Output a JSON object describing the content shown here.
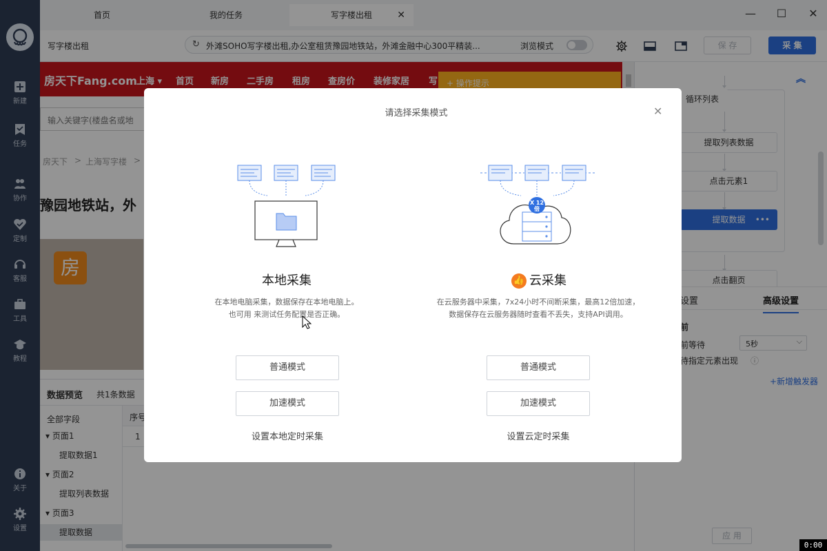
{
  "sidebar": {
    "items": [
      {
        "label": "新建"
      },
      {
        "label": "任务"
      },
      {
        "label": "协作"
      },
      {
        "label": "定制"
      },
      {
        "label": "客服"
      },
      {
        "label": "工具"
      },
      {
        "label": "教程"
      },
      {
        "label": "关于"
      },
      {
        "label": "设置"
      }
    ]
  },
  "tabs": [
    {
      "label": "首页"
    },
    {
      "label": "我的任务"
    },
    {
      "label": "写字楼出租"
    }
  ],
  "toolbar": {
    "task_title": "写字楼出租",
    "url": "外滩SOHO写字楼出租,办公室租赁豫园地铁站，外滩金融中心300平精装...",
    "browse_mode_label": "浏览模式",
    "save_label": "保 存",
    "collect_label": "采 集"
  },
  "webpage": {
    "logo": "房天下Fang.com",
    "city": "上海",
    "nav": [
      "首页",
      "新房",
      "二手房",
      "租房",
      "查房价",
      "装修家居",
      "写"
    ],
    "tip": "+ 操作提示",
    "search_placeholder": "输入关键字(楼盘名或地",
    "breadcrumb": [
      "房天下",
      ">",
      "上海写字楼",
      ">"
    ],
    "headline": "豫园地铁站，外",
    "photo_logo": "房"
  },
  "preview": {
    "title": "数据预览",
    "count": "共1条数据",
    "tree": [
      {
        "label": "全部字段"
      },
      {
        "label": "▾  页面1"
      },
      {
        "label": "提取数据1"
      },
      {
        "label": "▾  页面2"
      },
      {
        "label": "提取列表数据"
      },
      {
        "label": "▾  页面3"
      },
      {
        "label": "提取数据"
      }
    ],
    "col_header": "序号",
    "row_index": "1"
  },
  "right_panel": {
    "flow": {
      "loop_label": "循环列表",
      "extract_list": "提取列表数据",
      "click_element": "点击元素1",
      "extract_data": "提取数据",
      "next_page": "点击翻页"
    },
    "tab_basic": "设置",
    "tab_advanced": "高级设置",
    "section_before": "前",
    "wait_label": "前等待",
    "wait_value": "5秒",
    "wait_element": "待指定元素出现",
    "add_trigger": "+新增触发器",
    "apply_label": "应 用"
  },
  "modal": {
    "title": "请选择采集模式",
    "local": {
      "title": "本地采集",
      "desc1": "在本地电脑采集，数据保存在本地电脑上。",
      "desc2": "也可用 来测试任务配置是否正确。",
      "normal": "普通模式",
      "fast": "加速模式",
      "schedule": "设置本地定时采集"
    },
    "cloud": {
      "title": "云采集",
      "badge": "X 12倍",
      "desc1": "在云服务器中采集，7x24小时不间断采集，最高12倍加速，",
      "desc2": "数据保存在云服务器随时查看不丢失，支持API调用。",
      "normal": "普通模式",
      "fast": "加速模式",
      "schedule": "设置云定时采集"
    }
  },
  "timer": "0:00"
}
